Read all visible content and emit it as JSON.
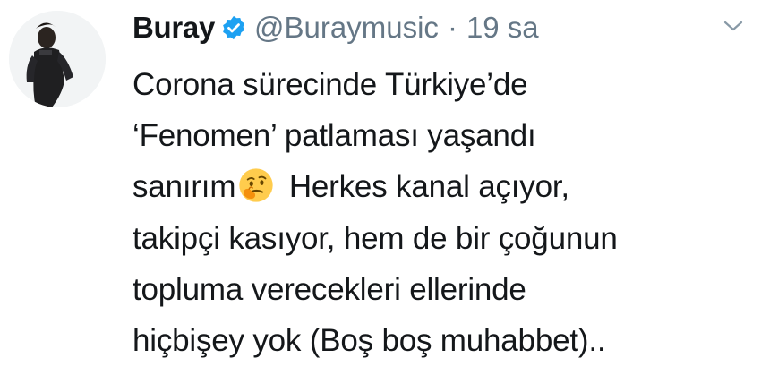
{
  "tweet": {
    "author_name": "Buray",
    "handle": "@Buraymusic",
    "separator": "·",
    "time": "19 sa",
    "lines": [
      "Corona sürecinde Türkiye’de",
      "‘Fenomen’ patlaması yaşandı",
      {
        "before": "sanırım",
        "after": "Herkes kanal açıyor,"
      },
      "takipçi kasıyor, hem de bir çoğunun",
      "topluma verecekleri ellerinde",
      "hiçbişey yok (Boş boş muhabbet).."
    ]
  },
  "icons": {
    "verified": "verified-badge-icon",
    "menu": "chevron-down-icon",
    "emoji": "thinking-face-emoji"
  },
  "colors": {
    "text": "#14171a",
    "secondary": "#657786",
    "verified_blue": "#1da1f2",
    "emoji_yellow": "#ffcc4d"
  }
}
